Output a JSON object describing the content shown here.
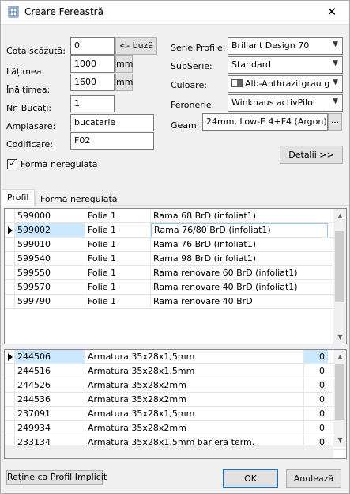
{
  "window": {
    "title": "Creare Fereastră",
    "close_glyph": "✕"
  },
  "left_form": {
    "cota_label": "Cota scăzută:",
    "cota_value": "0",
    "buza_button": "<- buză",
    "latime_label": "Lățimea:",
    "latime_value": "1000",
    "latime_unit": "mm",
    "inaltime_label": "Înălțimea:",
    "inaltime_value": "1600",
    "inaltime_unit": "mm",
    "bucati_label": "Nr. Bucăți:",
    "bucati_value": "1",
    "amplasare_label": "Amplasare:",
    "amplasare_value": "bucatarie",
    "codificare_label": "Codificare:",
    "codificare_value": "F02",
    "neregulata_label": "Formă neregulată",
    "neregulata_checked": true
  },
  "right_form": {
    "serie_label": "Serie Profile:",
    "serie_value": "Brillant Design 70",
    "subserie_label": "SubSerie:",
    "subserie_value": "Standard",
    "culoare_label": "Culoare:",
    "culoare_value": "Alb-Anthrazitgrau g",
    "feronerie_label": "Feronerie:",
    "feronerie_value": "Winkhaus activPilot",
    "geam_label": "Geam:",
    "geam_value": "24mm, Low-E 4+F4 (Argon)",
    "geam_button": "...",
    "detalii_button": "Detalii >>"
  },
  "tabs": [
    {
      "label": "Profil",
      "active": true
    },
    {
      "label": "Formă neregulată",
      "active": false
    }
  ],
  "profile_list": {
    "selected_index": 1,
    "rows": [
      {
        "code": "599000",
        "folie": "Folie 1",
        "desc": "Rama 68 BrD (infoliat1)"
      },
      {
        "code": "599002",
        "folie": "Folie 1",
        "desc": "Rama 76/80 BrD (infoliat1)"
      },
      {
        "code": "599010",
        "folie": "Folie 1",
        "desc": "Rama 76 BrD (infoliat1)"
      },
      {
        "code": "599540",
        "folie": "Folie 1",
        "desc": "Rama 98 BrD (infoliat1)"
      },
      {
        "code": "599550",
        "folie": "Folie 1",
        "desc": "Rama renovare 60 BrD (infoliat1)"
      },
      {
        "code": "599570",
        "folie": "Folie 1",
        "desc": "Rama renovare 40 BrD (infoliat1)"
      },
      {
        "code": "599790",
        "folie": "Folie 1",
        "desc": "Rama renovare 40 BrD"
      }
    ]
  },
  "reinforcement_list": {
    "selected_index": 0,
    "rows": [
      {
        "code": "244506",
        "desc": "Armatura 35x28x1,5mm",
        "qty": "0"
      },
      {
        "code": "244516",
        "desc": "Armatura 35x28x1,5mm",
        "qty": "0"
      },
      {
        "code": "244526",
        "desc": "Armatura 35x28x2mm",
        "qty": "0"
      },
      {
        "code": "244536",
        "desc": "Armatura 35x28x2mm",
        "qty": "0"
      },
      {
        "code": "237091",
        "desc": "Armatura 35x28x1,5mm",
        "qty": "0"
      },
      {
        "code": "249934",
        "desc": "Armatura 35x28x2mm",
        "qty": "0"
      },
      {
        "code": "233134",
        "desc": "Armatura 35x28x1,5mm bariera term.",
        "qty": "0"
      }
    ]
  },
  "footer": {
    "retine_button": "Reține ca Profil Implicit",
    "ok_button": "OK",
    "anuleaza_button": "Anulează"
  }
}
